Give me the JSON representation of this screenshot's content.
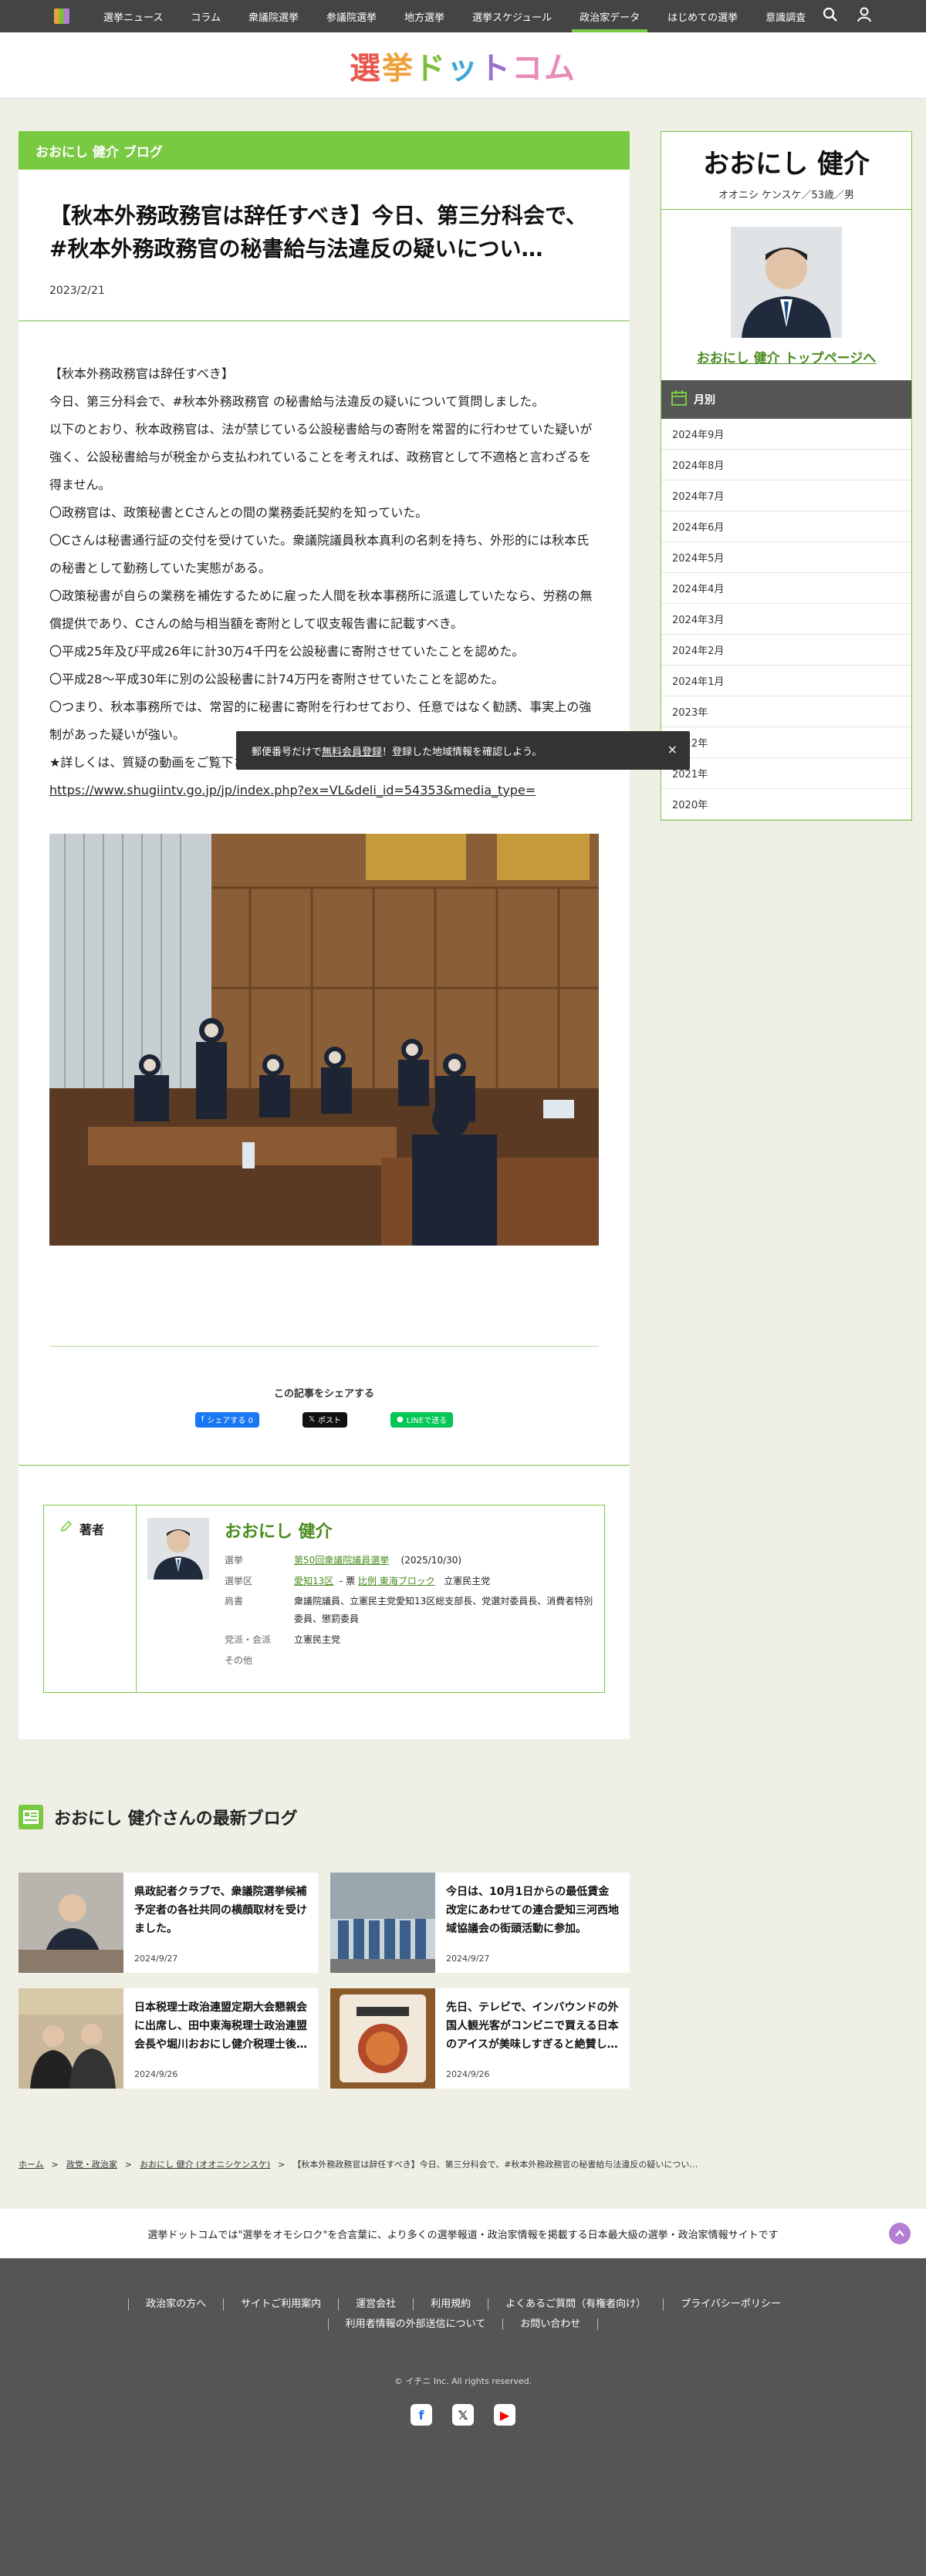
{
  "nav": {
    "items": [
      {
        "label": "選挙ニュース",
        "active": false
      },
      {
        "label": "コラム",
        "active": false
      },
      {
        "label": "衆議院選挙",
        "active": false
      },
      {
        "label": "参議院選挙",
        "active": false
      },
      {
        "label": "地方選挙",
        "active": false
      },
      {
        "label": "選挙スケジュール",
        "active": false
      },
      {
        "label": "政治家データ",
        "active": true
      },
      {
        "label": "はじめての選挙",
        "active": false
      },
      {
        "label": "意識調査",
        "active": false
      }
    ],
    "icons": [
      "search-icon",
      "user-icon"
    ]
  },
  "brand": {
    "chars": [
      "選",
      "挙",
      "ド",
      "ッ",
      "ト",
      "コム"
    ]
  },
  "article": {
    "band": "おおにし 健介 ブログ",
    "title": "【秋本外務政務官は辞任すべき】今日、第三分科会で、#秋本外務政務官の秘書給与法違反の疑いについ…",
    "date": "2023/2/21",
    "paragraphs": [
      "【秋本外務政務官は辞任すべき】",
      "今日、第三分科会で、#秋本外務政務官 の秘書給与法違反の疑いについて質問しました。",
      "以下のとおり、秋本政務官は、法が禁じている公設秘書給与の寄附を常習的に行わせていた疑いが強く、公設秘書給与が税金から支払われていることを考えれば、政務官として不適格と言わざるを得ません。",
      "〇政務官は、政策秘書とCさんとの間の業務委託契約を知っていた。",
      "〇Cさんは秘書通行証の交付を受けていた。衆議院議員秋本真利の名刺を持ち、外形的には秋本氏の秘書として勤務していた実態がある。",
      "〇政策秘書が自らの業務を補佐するために雇った人間を秋本事務所に派遣していたなら、労務の無償提供であり、Cさんの給与相当額を寄附として収支報告書に記載すべき。",
      "〇平成25年及び平成26年に計30万4千円を公設秘書に寄附させていたことを認めた。",
      "〇平成28〜平成30年に別の公設秘書に計74万円を寄附させていたことを認めた。",
      "〇つまり、秋本事務所では、常習的に秘書に寄附を行わせており、任意ではなく勧誘、事実上の強制があった疑いが強い。",
      "★詳しくは、質疑の動画をご覧下さい。"
    ],
    "link": "https://www.shugiintv.go.jp/jp/index.php?ex=VL&deli_id=54353&media_type="
  },
  "share": {
    "title": "この記事をシェアする",
    "facebook": "シェアする 0",
    "x": "ポスト",
    "line": "LINEで送る"
  },
  "author": {
    "label": "著者",
    "name": "おおにし 健介",
    "rows": [
      {
        "key": "選挙",
        "link": "第50回衆議院議員選挙",
        "extra": "(2025/10/30)"
      },
      {
        "key": "選挙区",
        "link": "愛知13区",
        "mid": "- 票",
        "link2": "比例 東海ブロック",
        "extra": "立憲民主党"
      },
      {
        "key": "肩書",
        "value": "衆議院議員、立憲民主党愛知13区総支部長、党選対委員長、消費者特別委員、懲罰委員"
      },
      {
        "key": "党派・会派",
        "value": "立憲民主党"
      },
      {
        "key": "その他",
        "value": ""
      }
    ]
  },
  "sidebar": {
    "name": "おおにし 健介",
    "kana": "オオニシ ケンスケ／53歳／男",
    "top_link": "おおにし 健介 トップページへ",
    "month_header": "月別",
    "months": [
      "2024年9月",
      "2024年8月",
      "2024年7月",
      "2024年6月",
      "2024年5月",
      "2024年4月",
      "2024年3月",
      "2024年2月",
      "2024年1月",
      "2023年",
      "2022年",
      "2021年",
      "2020年"
    ]
  },
  "toast": {
    "before": "郵便番号だけで",
    "link": "無料会員登録",
    "after": "！登録した地域情報を確認しよう。",
    "close": "×"
  },
  "latest": {
    "title": "おおにし 健介さんの最新ブログ",
    "cards": [
      {
        "title": "県政記者クラブで、衆議院選挙候補予定者の各社共同の横顔取材を受けました。",
        "date": "2024/9/27"
      },
      {
        "title": "今日は、10月1日からの最低賃金改定にあわせての連合愛知三河西地域協議会の街頭活動に参加。",
        "date": "2024/9/27"
      },
      {
        "title": "日本税理士政治連盟定期大会懇親会に出席し、田中東海税理士政治連盟会長や堀川おおにし健介税理士後…",
        "date": "2024/9/26"
      },
      {
        "title": "先日、テレビで、インバウンドの外国人観光客がコンビニで買える日本のアイスが美味しすぎると絶賛し…",
        "date": "2024/9/26"
      }
    ]
  },
  "breadcrumb": [
    "ホーム",
    "政党・政治家",
    "おおにし 健介 (オオニシケンスケ)",
    "【秋本外務政務官は辞任すべき】今日、第三分科会で、#秋本外務政務官の秘書給与法違反の疑いについ…"
  ],
  "tagline": "選挙ドットコムでは\"選挙をオモシロク\"を合言葉に、より多くの選挙報道・政治家情報を掲載する日本最大級の選挙・政治家情報サイトです",
  "footer": {
    "links": [
      "政治家の方へ",
      "サイトご利用案内",
      "運営会社",
      "利用規約",
      "よくあるご質問（有権者向け）",
      "プライバシーポリシー",
      "利用者情報の外部送信について",
      "お問い合わせ"
    ],
    "copyright": "© イチニ Inc. All rights reserved.",
    "social": [
      "facebook-icon",
      "x-icon",
      "youtube-icon"
    ]
  }
}
